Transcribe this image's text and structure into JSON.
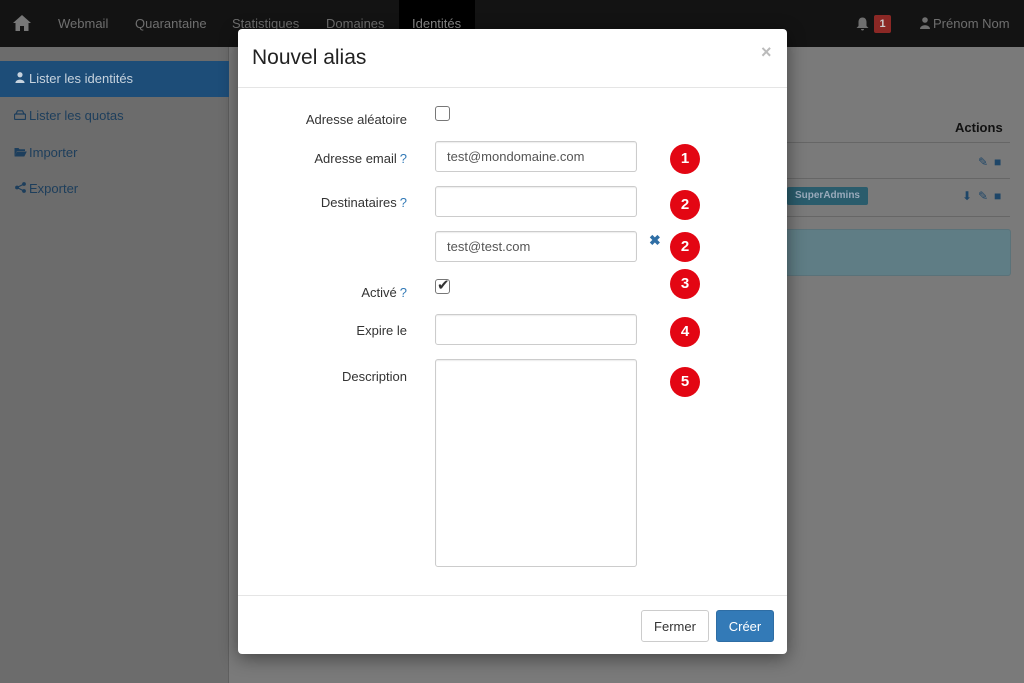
{
  "nav": {
    "items": [
      "Webmail",
      "Quarantaine",
      "Statistiques",
      "Domaines",
      "Identités"
    ],
    "notif_count": "1",
    "user": "Prénom Nom"
  },
  "sidebar": {
    "items": [
      {
        "label": "Lister les identités",
        "icon": "user-icon"
      },
      {
        "label": "Lister les quotas",
        "icon": "hdd-icon"
      },
      {
        "label": "Importer",
        "icon": "folder-open-icon"
      },
      {
        "label": "Exporter",
        "icon": "share-icon"
      }
    ]
  },
  "background": {
    "actions_header": "Actions",
    "tag": "SuperAdmins"
  },
  "modal": {
    "title": "Nouvel alias",
    "close": "×",
    "labels": {
      "random": "Adresse aléatoire",
      "email": "Adresse email",
      "recipients": "Destinataires",
      "active": "Activé",
      "expires": "Expire le",
      "description": "Description"
    },
    "help_mark": "?",
    "fields": {
      "email": "test@mondomaine.com",
      "recipient_1": "",
      "recipient_2": "test@test.com",
      "expires": "",
      "description": ""
    },
    "checkboxes": {
      "random": false,
      "active": true
    },
    "steps": [
      "1",
      "2",
      "2",
      "3",
      "4",
      "5"
    ],
    "buttons": {
      "close": "Fermer",
      "create": "Créer"
    }
  },
  "colors": {
    "primary": "#337ab7",
    "step_marker": "#e30613",
    "navbar": "#131313"
  }
}
